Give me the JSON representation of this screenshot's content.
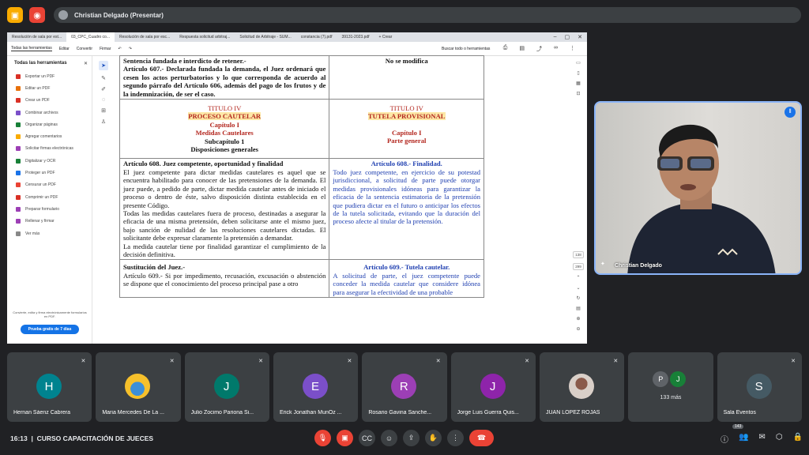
{
  "top": {
    "presenter_label": "Christian Delgado (Presentar)"
  },
  "browser": {
    "tabs": [
      "Resolución de sala por est...",
      "03_CPC_Cuadro co...",
      "Resolución de sala por esc...",
      "Respuesta solicitud arbitraj...",
      "Solicitud de Arbitraje - SUM...",
      "constancia (7).pdf",
      "39131-2023.pdf",
      "+ Crear"
    ],
    "toolbar": [
      "Todas las herramientas",
      "Editar",
      "Convertir",
      "Firmar"
    ],
    "search": "Buscar todo o herramientas"
  },
  "sidepanel": {
    "title": "Todas las herramientas",
    "items": [
      "Exportar un PDF",
      "Editar un PDF",
      "Crear un PDF",
      "Combinar archivos",
      "Organizar páginas",
      "Agregar comentarios",
      "Solicitar firmas electrónicas",
      "Digitalizar y OCR",
      "Proteger un PDF",
      "Censurar un PDF",
      "Comprimir un PDF",
      "Preparar formulario",
      "Rellenar y firmar",
      "Ver más"
    ],
    "footer": "Convierte, edita y firma electrónicamente formularios en PDF.",
    "trial_button": "Prueba gratis de 7 días"
  },
  "doc": {
    "r0l": "Sentencia fundada e interdicto de retener.-",
    "r0r": "No se modifica",
    "r1l": "Artículo 607.- Declarada fundada la demanda, el Juez ordenará que cesen los actos perturbatorios y lo que corresponda de acuerdo al segundo párrafo del Artículo 606, además del pago de los frutos y de la indemnización, de ser el caso.",
    "l_titulo": "TITULO IV",
    "l_proceso": "PROCESO CAUTELAR",
    "l_cap": "Capítulo I",
    "l_med": "Medidas Cautelares",
    "l_subcap": "Subcapítulo 1",
    "l_disp": "Disposiciones generales",
    "r_titulo": "TITULO IV",
    "r_tutela": "TUTELA PROVISIONAL",
    "r_cap": "Capítulo I",
    "r_parte": "Parte general",
    "a608_head": "Artículo 608. Juez competente, oportunidad y finalidad",
    "a608_p1": "El juez competente para dictar medidas cautelares es aquel que se encuentra habilitado para conocer de las pretensiones de la demanda. El juez puede, a pedido de parte, dictar medida cautelar antes de iniciado el proceso o dentro de éste, salvo disposición distinta establecida en el presente Código.",
    "a608_p2": "Todas las medidas cautelares fuera de proceso, destinadas a asegurar la eficacia de una misma pretensión, deben solicitarse ante el mismo juez, bajo sanción de nulidad de las resoluciones cautelares dictadas. El solicitante debe expresar claramente la pretensión a demandar.",
    "a608_p3": "La medida cautelar tiene por finalidad garantizar el cumplimiento de la decisión definitiva.",
    "a608r_head": "Artículo 608.- Finalidad.",
    "a608r_text": "Todo juez competente, en ejercicio de su potestad jurisdiccional, a solicitud de parte puede otorgar medidas provisionales idóneas para garantizar la eficacia de la sentencia estimatoria de la pretensión que pudiera dictar en el futuro o anticipar los efectos de la tutela solicitada, evitando que la duración del proceso afecte al titular de la pretensión.",
    "a609_head": "Sustitución del Juez.-",
    "a609_text": "Artículo 609.- Si por impedimento, recusación, excusación o abstención se dispone que el conocimiento del proceso principal pase a otro",
    "a609r_head": "Artículo 609.- Tutela cautelar.",
    "a609r_text": "A solicitud de parte, el juez competente puede conceder la medida cautelar que considere idónea para asegurar la efectividad de una probable"
  },
  "pages": [
    "138",
    "299"
  ],
  "speaker": {
    "name": "Christian Delgado"
  },
  "participants": [
    {
      "initial": "H",
      "name": "Hernan Sáenz Cabrera",
      "color": "#00838f"
    },
    {
      "initial": "",
      "name": "Maria Mercedes De La ...",
      "color": "#f6c02b"
    },
    {
      "initial": "J",
      "name": "Julio Zocimo Pariona Si...",
      "color": "#00796b"
    },
    {
      "initial": "E",
      "name": "Erick Jonathan MunOz ...",
      "color": "#7b4fc9"
    },
    {
      "initial": "R",
      "name": "Rosario Gavina Sanche...",
      "color": "#9c3fb5"
    },
    {
      "initial": "J",
      "name": "Jorge Luis Guerra Quis...",
      "color": "#8e24aa"
    },
    {
      "initial": "",
      "name": "JUAN LOPEZ ROJAS",
      "color": "#c9b5a8"
    }
  ],
  "more": {
    "a": "P",
    "b": "J",
    "count": "133 más"
  },
  "last_tile": {
    "initial": "S",
    "name": "Sala Eventos"
  },
  "bottom": {
    "time": "16:13",
    "meeting": "CURSO CAPACITACIÓN DE JUECES",
    "people_badge": "143"
  }
}
